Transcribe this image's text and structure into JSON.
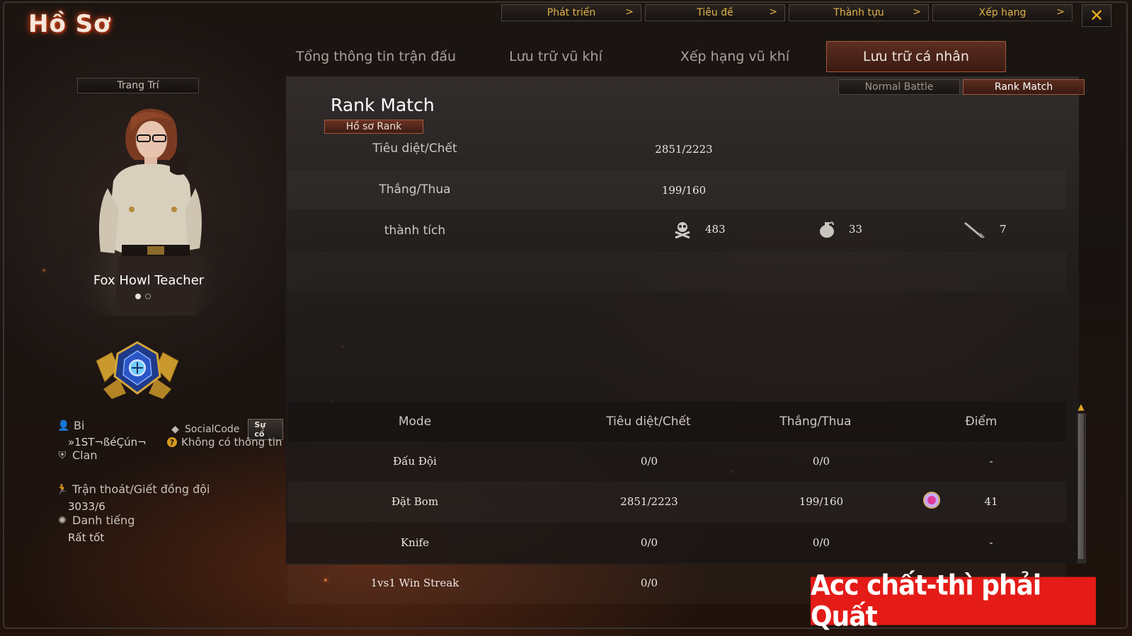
{
  "window": {
    "title": "Hồ Sơ",
    "close_icon": "close-icon"
  },
  "top_nav": [
    {
      "label": "Phát triển",
      "arrow": ">"
    },
    {
      "label": "Tiêu đề",
      "arrow": ">"
    },
    {
      "label": "Thành tựu",
      "arrow": ">"
    },
    {
      "label": "Xếp hạng",
      "arrow": ">"
    }
  ],
  "tabs": [
    {
      "label": "Tổng thông tin trận đấu",
      "active": false
    },
    {
      "label": "Lưu trữ vũ khí",
      "active": false
    },
    {
      "label": "Xếp hạng vũ khí",
      "active": false
    },
    {
      "label": "Lưu trữ cá nhân",
      "active": true
    }
  ],
  "left": {
    "decorate_label": "Trang Trí",
    "character_name": "Fox Howl Teacher",
    "carousel": {
      "current": 1,
      "total": 2
    },
    "player_label": "Bi",
    "player_name": "»1ST¬ßéÇún¬",
    "social_label": "SocialCode",
    "social_badge": "Sự cố",
    "social_value": "Không có thông tin",
    "clan_label": "Clan",
    "escape_label": "Trận thoát/Giết đồng đội",
    "escape_value": "3033/6",
    "reputation_label": "Danh tiếng",
    "reputation_value": "Rất tốt"
  },
  "mode_toggle": [
    {
      "label": "Normal Battle",
      "active": false
    },
    {
      "label": "Rank Match",
      "active": true
    }
  ],
  "rank": {
    "title": "Rank Match",
    "profile_button": "Hồ sơ Rank",
    "kd_label": "Tiêu diệt/Chết",
    "kd_value": "2851/2223",
    "wl_label": "Thắng/Thua",
    "wl_value": "199/160",
    "achievements_label": "thành tích",
    "achievements": [
      {
        "icon": "skull-crossbones-icon",
        "value": "483"
      },
      {
        "icon": "grenade-icon",
        "value": "33"
      },
      {
        "icon": "knife-icon",
        "value": "7"
      }
    ]
  },
  "table": {
    "headers": [
      "Mode",
      "Tiêu diệt/Chết",
      "Thắng/Thua",
      "Điểm"
    ],
    "rows": [
      {
        "mode": "Đấu Đội",
        "kd": "0/0",
        "wl": "0/0",
        "score": "-",
        "badge": false
      },
      {
        "mode": "Đặt Bom",
        "kd": "2851/2223",
        "wl": "199/160",
        "score": "41",
        "badge": true
      },
      {
        "mode": "Knife",
        "kd": "0/0",
        "wl": "0/0",
        "score": "-",
        "badge": false
      },
      {
        "mode": "1vs1 Win Streak",
        "kd": "0/0",
        "wl": "",
        "score": "",
        "badge": false
      }
    ]
  },
  "banner": "Acc chất-thì phải Quất",
  "colors": {
    "accent_gold": "#e0b248",
    "active_tab": "#5c2e20",
    "banner_red": "#e41b17"
  }
}
